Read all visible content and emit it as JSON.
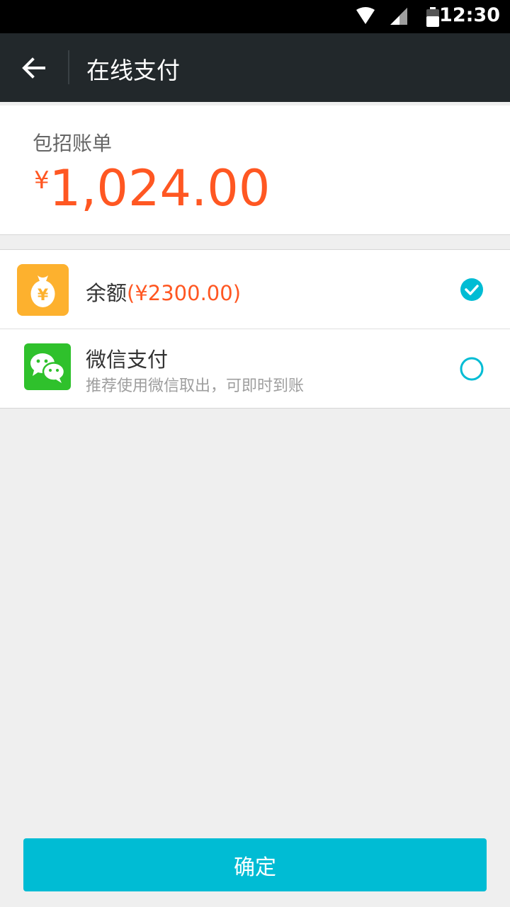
{
  "status_bar": {
    "time": "12:30",
    "icons": [
      "wifi-icon",
      "signal-icon",
      "battery-icon"
    ]
  },
  "app_bar": {
    "title": "在线支付",
    "back_icon": "arrow-left-icon"
  },
  "bill": {
    "label": "包招账单",
    "currency": "¥",
    "amount": "1,024.00"
  },
  "payment_methods": [
    {
      "title": "余额",
      "extra": "(¥2300.00)",
      "icon": "money-bag-icon",
      "selected": true
    },
    {
      "title": "微信支付",
      "subtitle": "推荐使用微信取出，可即时到账",
      "icon": "wechat-icon",
      "selected": false
    }
  ],
  "confirm_button": {
    "label": "确定"
  },
  "colors": {
    "accent": "#00bcd4",
    "amount": "#ff5722",
    "app_bar": "#22282b",
    "balance_icon_bg": "#fdb12e",
    "wechat_icon_bg": "#2fc12c"
  }
}
